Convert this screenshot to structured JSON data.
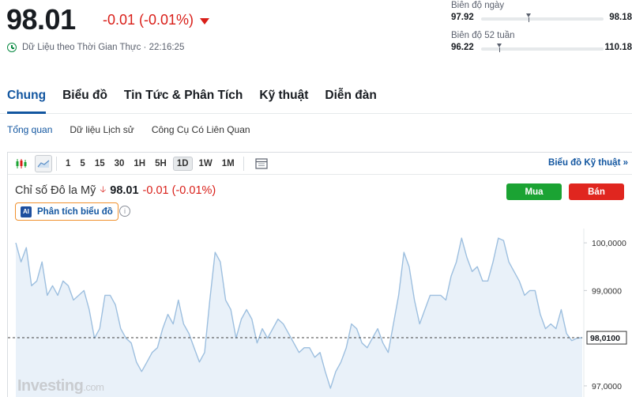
{
  "quote": {
    "price": "98.01",
    "change": "-0.01 (-0.01%)",
    "realtime_text": "Dữ Liệu theo Thời Gian Thực · 22:16:25",
    "down_color": "#d91e18"
  },
  "ranges": [
    {
      "label": "Biên độ ngày",
      "low": "97.92",
      "high": "98.18",
      "position": 0.37
    },
    {
      "label": "Biên độ 52 tuần",
      "low": "96.22",
      "high": "110.18",
      "position": 0.13
    }
  ],
  "tabs": [
    "Chung",
    "Biểu đồ",
    "Tin Tức & Phân Tích",
    "Kỹ thuật",
    "Diễn đàn"
  ],
  "subtabs": [
    "Tổng quan",
    "Dữ liệu Lịch sử",
    "Công Cụ Có Liên Quan"
  ],
  "toolbar": {
    "candles_icon": "candlestick-icon",
    "area_icon": "area-chart-icon",
    "timeframes": [
      "1",
      "5",
      "15",
      "30",
      "1H",
      "5H",
      "1D",
      "1W",
      "1M"
    ],
    "active_timeframe": "1D",
    "calendar_icon": "calendar-icon",
    "tech_link": "Biểu đồ Kỹ thuật »"
  },
  "instrument": {
    "name": "Chỉ số Đô la Mỹ",
    "value": "98.01",
    "change": "-0.01 (-0.01%)"
  },
  "actions": {
    "buy": "Mua",
    "sell": "Bán"
  },
  "ai_button": {
    "badge": "AI",
    "label": "Phân tích biểu đồ"
  },
  "brand": {
    "name": "Investing",
    "suffix": ".com"
  },
  "chart_data": {
    "type": "area",
    "y_ticks": [
      "100,0000",
      "99,0000",
      "97,0000"
    ],
    "last_label": "98,0100",
    "last_value": 98.01,
    "ylim": [
      96.75,
      100.3
    ],
    "line_color": "#9dbfdf",
    "fill_color": "#e9f1f9",
    "values": [
      100.0,
      99.6,
      99.9,
      99.1,
      99.2,
      99.6,
      98.9,
      99.1,
      98.9,
      99.2,
      99.1,
      98.8,
      98.9,
      99.0,
      98.6,
      98.0,
      98.2,
      98.9,
      98.9,
      98.7,
      98.2,
      98.0,
      97.9,
      97.5,
      97.3,
      97.5,
      97.7,
      97.8,
      98.2,
      98.5,
      98.3,
      98.8,
      98.3,
      98.1,
      97.8,
      97.5,
      97.7,
      98.8,
      99.8,
      99.6,
      98.8,
      98.6,
      98.0,
      98.4,
      98.6,
      98.4,
      97.9,
      98.2,
      98.0,
      98.2,
      98.4,
      98.3,
      98.1,
      97.9,
      97.7,
      97.8,
      97.8,
      97.6,
      97.7,
      97.3,
      96.95,
      97.3,
      97.5,
      97.8,
      98.3,
      98.2,
      97.9,
      97.8,
      98.0,
      98.2,
      97.9,
      97.7,
      98.3,
      98.9,
      99.8,
      99.5,
      98.8,
      98.3,
      98.6,
      98.9,
      98.9,
      98.9,
      98.8,
      99.3,
      99.6,
      100.1,
      99.7,
      99.4,
      99.5,
      99.2,
      99.2,
      99.6,
      100.1,
      100.05,
      99.6,
      99.4,
      99.2,
      98.9,
      99.0,
      99.0,
      98.5,
      98.2,
      98.3,
      98.2,
      98.6,
      98.1,
      97.95,
      98.0,
      98.01
    ]
  }
}
